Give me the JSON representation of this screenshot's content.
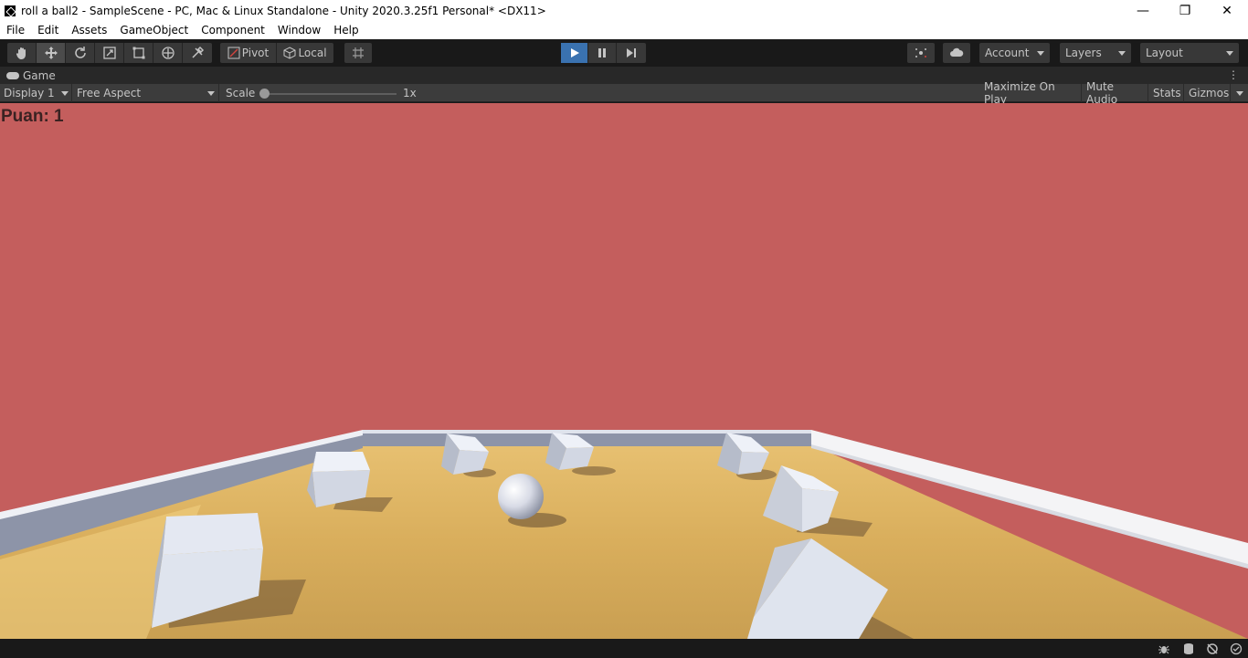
{
  "window": {
    "title": "roll a ball2 - SampleScene - PC, Mac & Linux Standalone - Unity 2020.3.25f1 Personal* <DX11>",
    "controls": {
      "minimize": "—",
      "maximize": "❐",
      "close": "✕"
    }
  },
  "menu": [
    "File",
    "Edit",
    "Assets",
    "GameObject",
    "Component",
    "Window",
    "Help"
  ],
  "toolbar": {
    "tools": [
      "hand-tool-icon",
      "move-tool-icon",
      "rotate-tool-icon",
      "scale-tool-icon",
      "rect-tool-icon",
      "transform-tool-icon",
      "custom-tool-icon"
    ],
    "pivot_label": "Pivot",
    "local_label": "Local",
    "account_label": "Account",
    "layers_label": "Layers",
    "layout_label": "Layout"
  },
  "game_tab": {
    "label": "Game",
    "display": "Display 1",
    "aspect": "Free Aspect",
    "scale_label": "Scale",
    "scale_value": "1x",
    "scale_fraction": 0.0,
    "maximize_on_play": "Maximize On Play",
    "mute_audio": "Mute Audio",
    "stats": "Stats",
    "gizmos": "Gizmos"
  },
  "game_view": {
    "score_text": "Puan: 1",
    "sky_color": "#c45e5d",
    "floor_color": "#e2b765",
    "wall_color": "#f2f2f2"
  },
  "colors": {
    "play_active": "#3a72b0",
    "toolbar_bg": "#191919",
    "button_bg": "#383838"
  }
}
